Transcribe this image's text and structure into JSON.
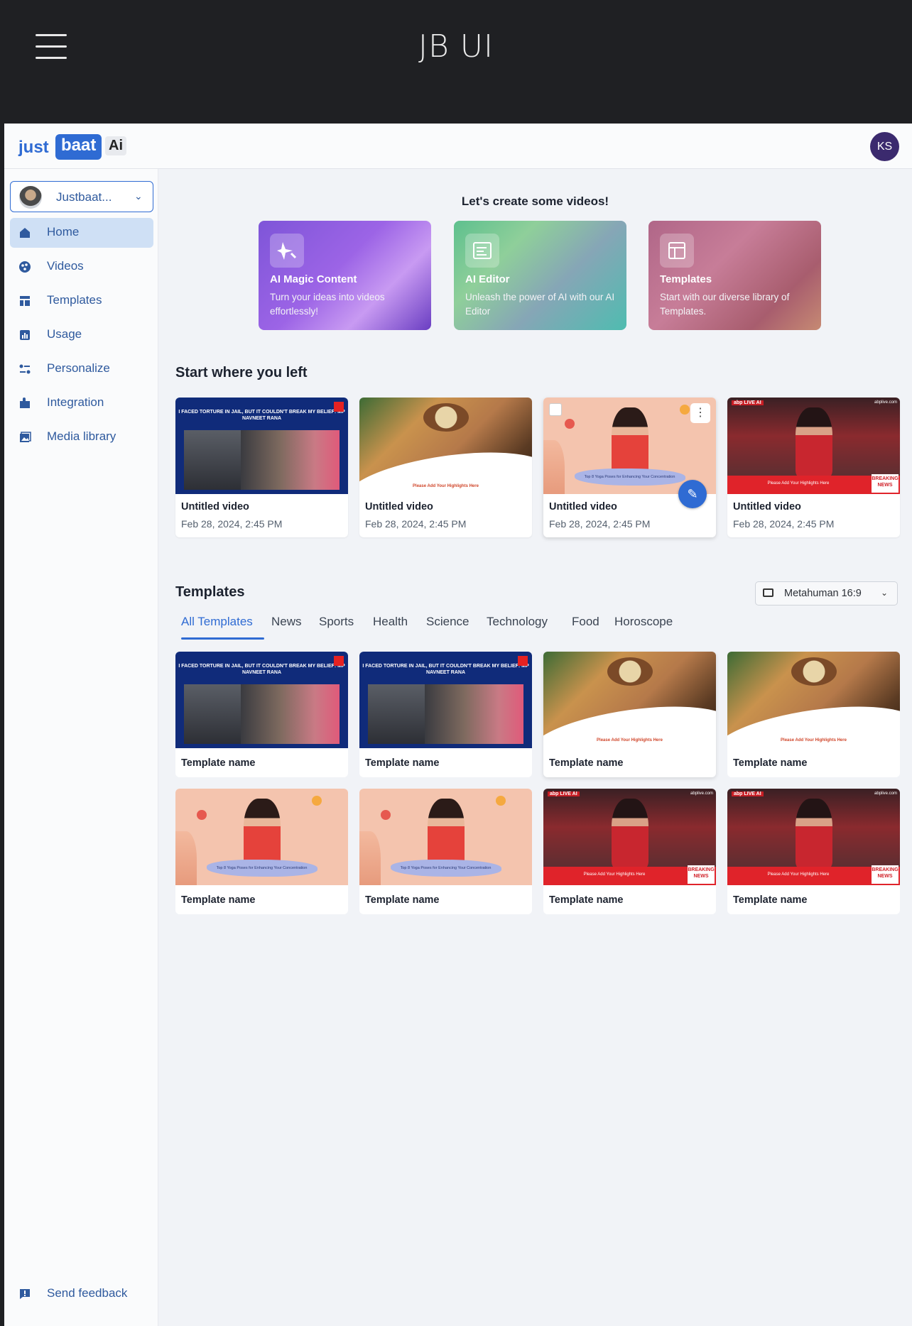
{
  "window": {
    "title": "JB UI"
  },
  "header": {
    "logo_just": "just",
    "logo_baat": "baat",
    "logo_ai": "Ai",
    "user_initials": "KS"
  },
  "sidebar": {
    "account_name": "Justbaat...",
    "items": [
      {
        "label": "Home",
        "icon": "home-icon",
        "active": true
      },
      {
        "label": "Videos",
        "icon": "videos-icon"
      },
      {
        "label": "Templates",
        "icon": "templates-icon"
      },
      {
        "label": "Usage",
        "icon": "usage-icon"
      },
      {
        "label": "Personalize",
        "icon": "personalize-icon"
      },
      {
        "label": "Integration",
        "icon": "integration-icon"
      },
      {
        "label": "Media library",
        "icon": "media-library-icon"
      }
    ],
    "feedback": "Send feedback"
  },
  "hero": {
    "title": "Let's create some videos!",
    "cards": [
      {
        "title": "AI Magic Content",
        "desc": "Turn your ideas into videos effortlessly!",
        "icon": "magic-star-icon"
      },
      {
        "title": "AI Editor",
        "desc": "Unleash the power of AI with our AI Editor",
        "icon": "editor-icon"
      },
      {
        "title": "Templates",
        "desc": "Start with our diverse library of Templates.",
        "icon": "template-layout-icon"
      }
    ]
  },
  "recent": {
    "title": "Start where you left",
    "videos": [
      {
        "title": "Untitled video",
        "date": "Feb 28, 2024, 2:45 PM"
      },
      {
        "title": "Untitled video",
        "date": "Feb 28, 2024, 2:45 PM"
      },
      {
        "title": "Untitled video",
        "date": "Feb 28, 2024, 2:45 PM"
      },
      {
        "title": "Untitled video",
        "date": "Feb 28, 2024, 2:45 PM"
      }
    ]
  },
  "templates": {
    "title": "Templates",
    "aspect_select": "Metahuman 16:9",
    "tabs": [
      "All Templates",
      "News",
      "Sports",
      "Health",
      "Science",
      "Technology",
      "Food",
      "Horoscope"
    ],
    "items": [
      {
        "name": "Template name"
      },
      {
        "name": "Template name"
      },
      {
        "name": "Template name"
      },
      {
        "name": "Template name"
      },
      {
        "name": "Template name"
      },
      {
        "name": "Template name"
      },
      {
        "name": "Template name"
      },
      {
        "name": "Template name"
      }
    ]
  },
  "thumbs": {
    "news_headline": "I FACED TORTURE IN JAIL, BUT IT COULDN'T BREAK MY BELIEF: MP NAVNEET RANA",
    "food_caption": "Please Add Your Highlights Here",
    "yoga_caption": "Top 8 Yoga Poses for Enhancing Your Concentration",
    "abp_caption": "Please Add Your Highlights Here",
    "abp_breaking": "BREAKING NEWS",
    "abp_brand": "abp LIVE AI",
    "abp_site": "abplive.com"
  }
}
